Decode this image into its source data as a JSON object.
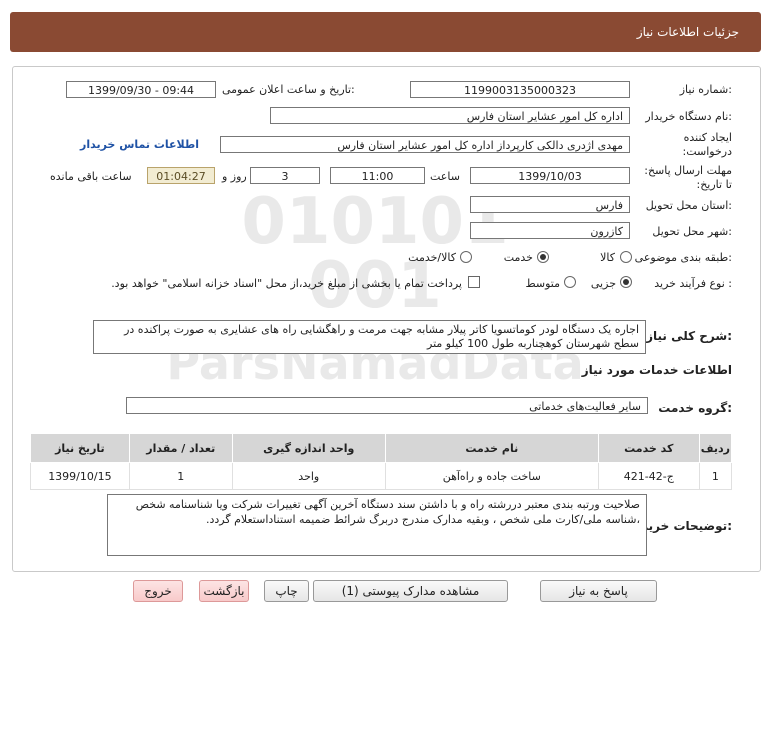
{
  "header": {
    "title": "جزئیات اطلاعات نیاز"
  },
  "fields": {
    "need_number_label": "شماره نیاز:",
    "need_number": "1199003135000323",
    "announce_label": "تاریخ و ساعت اعلان عمومی:",
    "announce_value": "1399/09/30 - 09:44",
    "buyer_label": "نام دستگاه خریدار:",
    "buyer_value": "اداره کل امور عشایر استان فارس",
    "creator_label": "ایجاد کننده درخواست:",
    "creator_value": "مهدی اژدری دالکی  کارپرداز اداره کل امور عشایر استان فارس",
    "contact_link": "اطلاعات تماس خریدار",
    "deadline_label": "مهلت ارسال پاسخ: تا تاریخ:",
    "deadline_date": "1399/10/03",
    "time_label": "ساعت",
    "deadline_time": "11:00",
    "days_value": "3",
    "days_label": "روز و",
    "remaining_time": "01:04:27",
    "remaining_label": "ساعت باقی مانده",
    "province_label": "استان محل تحویل:",
    "province_value": "فارس",
    "city_label": "شهر محل تحویل:",
    "city_value": "کازرون",
    "category_label": "طبقه بندی موضوعی:",
    "category_options": [
      "کالا",
      "خدمت",
      "کالا/خدمت"
    ],
    "category_selected": "خدمت",
    "purchase_label": "نوع فرآیند خرید :",
    "purchase_options": [
      "جزیی",
      "متوسط"
    ],
    "purchase_selected": "جزیی",
    "payment_text": "پرداخت تمام یا بخشی از مبلغ خرید،از محل \"اسناد خزانه اسلامی\" خواهد بود."
  },
  "description": {
    "label": "شرح کلی نیاز:",
    "text": "اجاره  یک دستگاه لودر کوماتسویا کاتر پیلار  مشابه جهت مرمت و راهگشایی راه های عشایری به صورت پراکنده در سطح  شهرستان کوهچنار‌به طول 100 کیلو متر"
  },
  "services": {
    "section_title": "اطلاعات خدمات مورد نیاز",
    "group_label": "گروه خدمت:",
    "group_value": "سایر فعالیت‌های خدماتی",
    "columns": [
      "ردیف",
      "کد خدمت",
      "نام خدمت",
      "واحد اندازه گیری",
      "تعداد / مقدار",
      "تاریخ نیاز"
    ],
    "rows": [
      {
        "row": "1",
        "code": "ج-42-421",
        "name": "ساخت جاده و راه‌آهن",
        "unit": "واحد",
        "qty": "1",
        "date": "1399/10/15"
      }
    ]
  },
  "buyer_notes": {
    "label": "توضیحات خریدار:",
    "text": "صلاحیت ورتبه بندی معتبر دررشته راه و با داشتن سند دستگاه آخرین آگهی تغییرات شرکت ویا شناسنامه شخص ،شناسه ملی/کارت ملی شخص ، وبقیه مدارک مندرج دربرگ شرائط ضمیمه استناداستعلام گردد."
  },
  "buttons": {
    "reply": "پاسخ به نیاز",
    "attachments": "مشاهده مدارک پیوستی (1)",
    "print": "چاپ",
    "back": "بازگشت",
    "exit": "خروج"
  },
  "watermark": {
    "text": "ParsNamadData"
  }
}
